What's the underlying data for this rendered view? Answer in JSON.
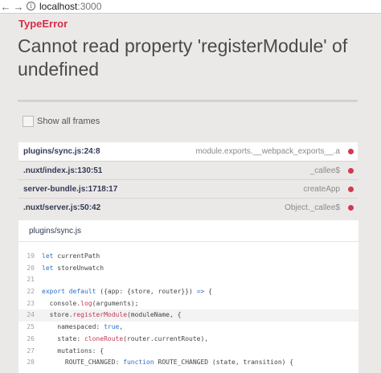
{
  "browser": {
    "back_icon": "back-arrow-icon",
    "forward_icon": "forward-arrow-icon",
    "info_icon": "info-icon",
    "url_host": "localhost",
    "url_port": ":3000"
  },
  "error": {
    "type": "TypeError",
    "message": "Cannot read property 'registerModule' of undefined"
  },
  "frames_toggle": {
    "label": "Show all frames",
    "checked": false
  },
  "frames": [
    {
      "file": "plugins/sync.js:24:8",
      "method": "module.exports.__webpack_exports__.a",
      "active": true
    },
    {
      "file": ".nuxt/index.js:130:51",
      "method": "_callee$",
      "active": false
    },
    {
      "file": "server-bundle.js:1718:17",
      "method": "createApp",
      "active": false
    },
    {
      "file": ".nuxt/server.js:50:42",
      "method": "Object._callee$",
      "active": false
    }
  ],
  "code_panel": {
    "file": "plugins/sync.js",
    "lines": [
      {
        "n": "19",
        "t": "let currentPath"
      },
      {
        "n": "20",
        "t": "let storeUnwatch"
      },
      {
        "n": "21",
        "t": ""
      },
      {
        "n": "22",
        "t": "export default ({app: {store, router}}) => {"
      },
      {
        "n": "23",
        "t": "  console.log(arguments);"
      },
      {
        "n": "24",
        "t": "  store.registerModule(moduleName, {"
      },
      {
        "n": "25",
        "t": "    namespaced: true,"
      },
      {
        "n": "26",
        "t": "    state: cloneRoute(router.currentRoute),"
      },
      {
        "n": "27",
        "t": "    mutations: {"
      },
      {
        "n": "28",
        "t": "      ROUTE_CHANGED: function ROUTE_CHANGED (state, transition) {"
      }
    ],
    "highlight_line": "24"
  },
  "colors": {
    "error_accent": "#d62d48",
    "frame_dot": "#d2394f",
    "keyword": "#2b6fc9",
    "function": "#c23a55"
  }
}
